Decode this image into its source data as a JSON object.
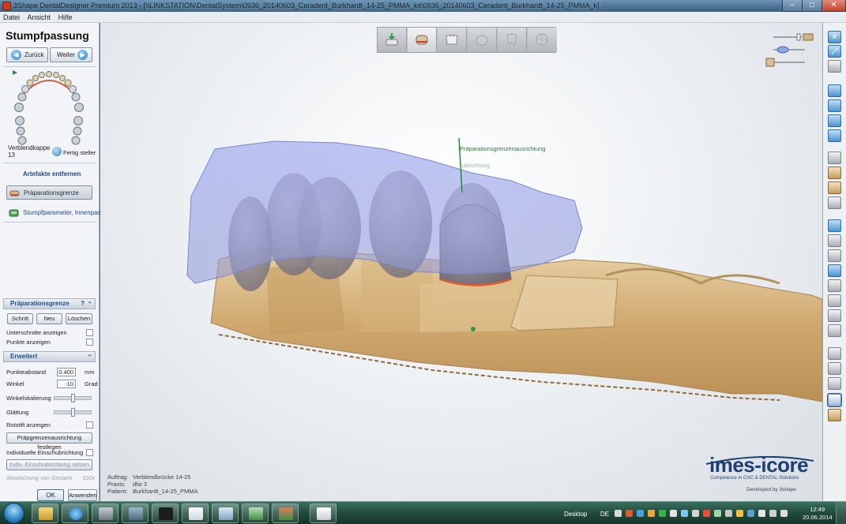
{
  "window": {
    "title": "3Shape DentalDesigner Premium 2013 - [\\\\LINKSTATION\\DentalSystem\\0936_20140603_Ceradent_Burkhardt_14-25_PMMA_kit\\0936_20140603_Ceradent_Burkhardt_14-25_PMMA_k]",
    "min_glyph": "–",
    "max_glyph": "□",
    "close_glyph": "✕"
  },
  "menu": [
    "Datei",
    "Ansicht",
    "Hilfe"
  ],
  "left": {
    "stage_title": "Stumpfpassung",
    "back_label": "Zurück",
    "next_label": "Weiter",
    "case_label": "Verblendkappe",
    "case_number": "13",
    "ready_label": "Fertig steller",
    "steps": [
      {
        "label": "Artefakte entfernen"
      },
      {
        "label": "Präparationsgrenze"
      },
      {
        "label": "Stumpfparameter, Innenpas"
      }
    ],
    "prep_panel": {
      "title": "Präparationsgrenze",
      "help": "?",
      "btn_step": "Schritt",
      "btn_new": "Neu",
      "btn_delete": "Löschen",
      "undercuts": "Unterschnitte anzeigen",
      "points": "Punkte anzeigen"
    },
    "advanced_panel": {
      "title": "Erweitert",
      "point_distance_label": "Punkteabstand",
      "point_distance_value": "0.400",
      "point_distance_unit": "mm",
      "angle_label": "Winkel",
      "angle_value": "-10",
      "angle_unit": "Grad",
      "angle_scaling_label": "Winkelskalierung",
      "angle_scaling_level": 0.5,
      "smoothing_label": "Glättung",
      "smoothing_level": 0.5,
      "red_pen_label": "Rotstift anzeigen",
      "set_direction_btn": "Präpgrenzenausrichtung festlegen",
      "individual_direction_label": "Individuelle Einschubrichtung",
      "set_individual_btn": "Indiv. Einschubrichtung setzen",
      "deviation_label": "Abweichung von Gesamt",
      "deviation_value": "10Gr"
    },
    "ok_label": "OK",
    "apply_label": "Anwenden"
  },
  "viewport": {
    "prep_direction_label": "Präparationsgrenzenausrichtung",
    "ghost_label": "ubrichtung",
    "info": [
      {
        "key": "Auftrag:",
        "value": "Verblendbrücke 14-25"
      },
      {
        "key": "Praxis:",
        "value": "dfw 3"
      },
      {
        "key": "Patient:",
        "value": "Burkhardt_14-25_PMMA"
      }
    ],
    "logo_main": "imes-icore",
    "logo_sub": "Competence in CNC & DENTAL-Solutions",
    "logo_dev": "Developed by 3shape"
  },
  "taskbar": {
    "desktop_label": "Desktop",
    "lang": "DE",
    "time": "12:49",
    "date": "20.06.2014"
  },
  "colors": {
    "accent": "#1c4f92",
    "model_tan": "#cfae7a",
    "wax_blue": "#8c95d8",
    "taskbar": "#214b3d"
  }
}
